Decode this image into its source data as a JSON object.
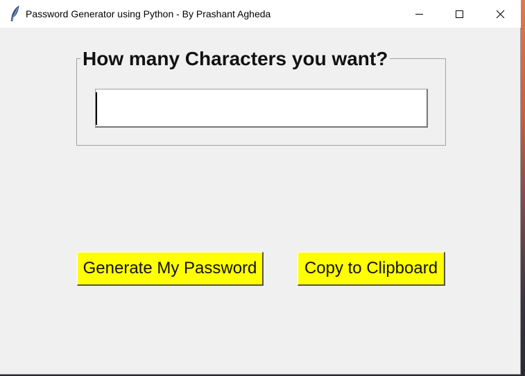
{
  "window": {
    "title": "Password Generator using Python - By Prashant Agheda",
    "icon": "feather-icon",
    "controls": [
      "minimize-icon",
      "maximize-icon",
      "close-icon"
    ]
  },
  "form": {
    "frame_label": "How many Characters you want?",
    "length_value": "",
    "generate_label": "Generate My Password",
    "copy_label": "Copy to Clipboard"
  },
  "colors": {
    "button_bg": "#ffff00",
    "window_bg": "#f0f0f0",
    "titlebar_bg": "#ffffff"
  }
}
